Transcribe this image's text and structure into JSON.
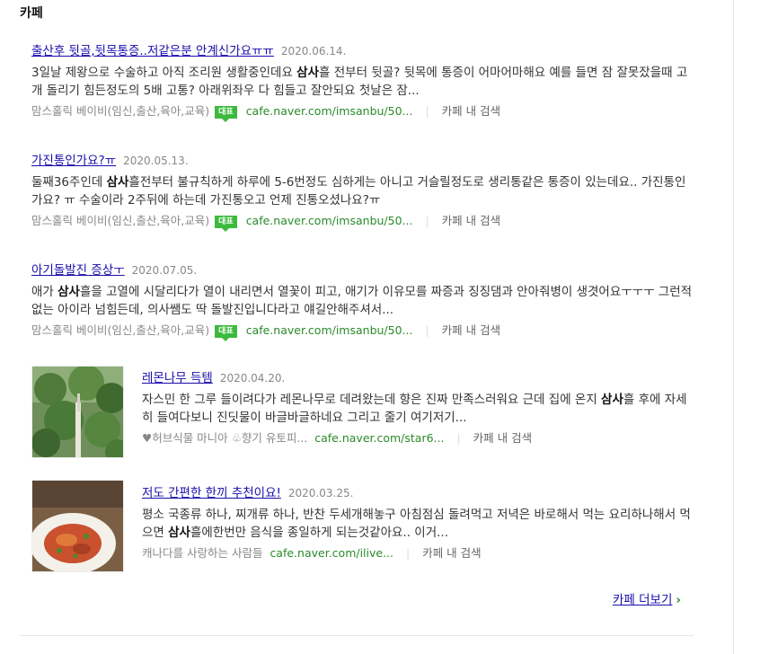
{
  "section": {
    "title": "카페"
  },
  "colors": {
    "title_link": "#1a0dab",
    "url": "#2a8a2a",
    "badge": "#3dba3d"
  },
  "posts": [
    {
      "title": "출산후 뒷골,뒷목통증..저같은분 안계신가요ㅠㅠ",
      "date": "2020.06.14.",
      "snippet_a": "3일날 제왕으로 수술하고 아직 조리원 생활중인데요 ",
      "snippet_bold": "삼사",
      "snippet_b": "흘 전부터 뒷골? 뒷목에 통증이 어마어마해요 예를 들면 잠 잘못잤을때 고개 돌리기 힘든정도의 5배 고통? 아래위좌우 다 힘들고 잘안되요 첫날은 잠...",
      "cafe": "맘스홀릭 베이비(임신,출산,육아,교육)",
      "badge": "대표",
      "url": "cafe.naver.com/imsanbu/50...",
      "search_label": "카페 내 검색"
    },
    {
      "title": "가진통인가요?ㅠ",
      "date": "2020.05.13.",
      "snippet_a": "둘째36주인데 ",
      "snippet_bold": "삼사",
      "snippet_b": "흘전부터 불규칙하게 하루에 5-6번정도 심하게는 아니고 거슬릴정도로 생리통같은 통증이 있는데요.. 가진통인가요? ㅠ 수술이라 2주뒤에 하는데 가진통오고 언제 진통오셨나요?ㅠ",
      "cafe": "맘스홀릭 베이비(임신,출산,육아,교육)",
      "badge": "대표",
      "url": "cafe.naver.com/imsanbu/50...",
      "search_label": "카페 내 검색"
    },
    {
      "title": "아기돌발진 증상ㅜ",
      "date": "2020.07.05.",
      "snippet_a": "애가 ",
      "snippet_bold": "삼사",
      "snippet_b": "흘을 고열에 시달리다가 열이 내리면서 열꽃이 피고, 애기가 이유모를 짜증과 징징댐과 안아줘병이 생겻어요ㅜㅜㅜ 그런적없는 아이라 넘힘든데, 의사쌤도 딱 돌발진입니다라고 얘길안해주셔서...",
      "cafe": "맘스홀릭 베이비(임신,출산,육아,교육)",
      "badge": "대표",
      "url": "cafe.naver.com/imsanbu/50...",
      "search_label": "카페 내 검색"
    },
    {
      "title": "레몬나무 득템",
      "date": "2020.04.20.",
      "snippet_a": "자스민 한 그루 들이려다가 레몬나무로 데려왔는데 향은 진짜 만족스러워요 근데 집에 온지 ",
      "snippet_bold": "삼사",
      "snippet_b": "흘 후에 자세히 들여다보니 진딧물이 바글바글하네요 그리고 줄기 여기저기...",
      "cafe": "♥허브식물 마니아 ♧향기 유토피...",
      "url": "cafe.naver.com/star6...",
      "search_label": "카페 내 검색"
    },
    {
      "title": "저도 간편한 한끼 추천이요!",
      "date": "2020.03.25.",
      "snippet_a": "평소 국종류 하나, 찌개류 하나, 반찬 두세개해놓구 아침점심 돌려먹고 저녁은 바로해서 먹는 요리하나해서 먹으면 ",
      "snippet_bold": "삼사",
      "snippet_b": "흘에한번만 음식을 종일하게 되는것같아요.. 이거...",
      "cafe": "캐나다를 사랑하는 사람들",
      "url": "cafe.naver.com/ilive...",
      "search_label": "카페 내 검색"
    }
  ],
  "more": {
    "label": "카페 더보기",
    "chevron": "›"
  }
}
